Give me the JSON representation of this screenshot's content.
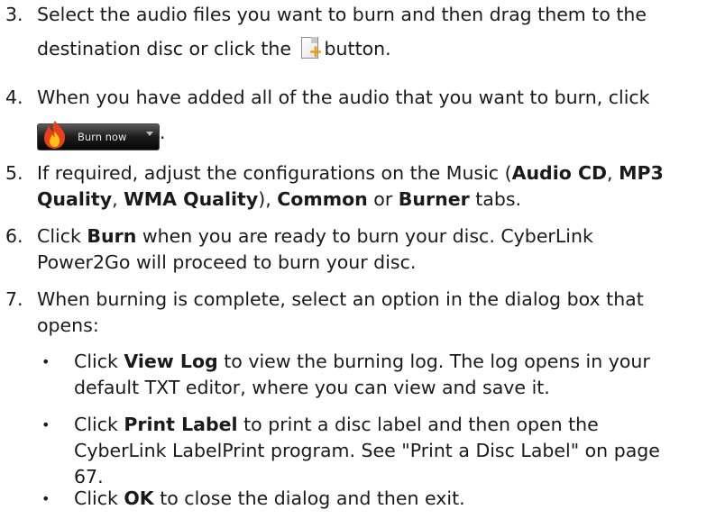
{
  "steps": [
    {
      "number": "3.",
      "line1": "Select the audio files you want to burn and then drag them to the",
      "line2_before": "destination disc or click the",
      "line2_after": "button."
    },
    {
      "number": "4.",
      "line1": "When you have added all of the audio that you want to burn, click",
      "period": "."
    },
    {
      "number": "5.",
      "line1_a": "If required, adjust the configurations on the Music (",
      "line1_bold1": "Audio CD",
      "line1_sep": ", ",
      "line1_bold2": "MP3",
      "line2_bold1": "Quality",
      "line2_sep1": ", ",
      "line2_bold2": "WMA Quality",
      "line2_sep2": "), ",
      "line2_bold3": "Common",
      "line2_sep3": " or ",
      "line2_bold4": "Burner",
      "line2_end": " tabs."
    },
    {
      "number": "6.",
      "line1_a": "Click ",
      "line1_bold": "Burn",
      "line1_b": " when you are ready to burn your disc. CyberLink",
      "line2": "Power2Go will proceed to burn your disc."
    },
    {
      "number": "7.",
      "line1": "When burning is complete, select an option in the dialog box that",
      "line2": "opens:"
    }
  ],
  "bullets": [
    {
      "marker": "•",
      "line1_a": "Click ",
      "line1_bold": "View Log",
      "line1_b": " to view the burning log. The log opens in your",
      "line2": "default TXT editor, where you can view and save it."
    },
    {
      "marker": "•",
      "line1_a": "Click ",
      "line1_bold": "Print Label",
      "line1_b": " to print a disc label and then open the",
      "line2": "CyberLink LabelPrint program. See \"Print a Disc Label\" on page",
      "line3": "67."
    },
    {
      "marker": "•",
      "line1_a": "Click ",
      "line1_bold": "OK",
      "line1_b": " to close the dialog and then exit."
    }
  ],
  "burn_button": {
    "label": "Burn now",
    "icon": "flame-icon",
    "colors": {
      "background": "#1c1c1c",
      "flame_outer": "#e8401a",
      "flame_inner": "#ffc21a"
    }
  },
  "add_button": {
    "icon": "add-file-icon",
    "accent": "#f0a000"
  }
}
